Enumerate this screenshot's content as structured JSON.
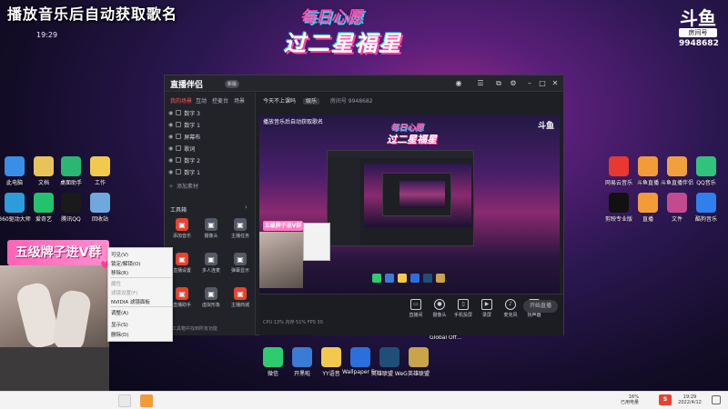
{
  "overlay": {
    "title": "播放音乐后自动获取歌名",
    "time": "19:29",
    "wish_line1": "每日心愿",
    "wish_line2": "过二星福星",
    "level_banner": "五级牌子进V群"
  },
  "platform": {
    "logo": "斗鱼",
    "room_label": "房间号",
    "room_number": "9948682"
  },
  "desktop_left": [
    {
      "label": "此电脑",
      "icon": "computer-icon",
      "color": "#3a8ee6"
    },
    {
      "label": "文档",
      "icon": "document-icon",
      "color": "#e8c35a"
    },
    {
      "label": "桌面助手",
      "icon": "assistant-icon",
      "color": "#2bb673"
    },
    {
      "label": "工作",
      "icon": "folder-icon",
      "color": "#f2c94c"
    },
    {
      "label": "360驱动大师",
      "icon": "driver-icon",
      "color": "#2d9cdb"
    },
    {
      "label": "爱奇艺",
      "icon": "iqiyi-icon",
      "color": "#25c26e"
    },
    {
      "label": "腾讯QQ",
      "icon": "qq-icon",
      "color": "#1a1a1a"
    },
    {
      "label": "回收站",
      "icon": "recycle-bin-icon",
      "color": "#6ea8dc"
    }
  ],
  "desktop_right": [
    {
      "label": "网易云音乐",
      "icon": "netease-music-icon",
      "color": "#e8382f"
    },
    {
      "label": "斗鱼直播",
      "icon": "douyu-icon",
      "color": "#f29b38"
    },
    {
      "label": "斗鱼直播伴侣",
      "icon": "douyu-companion-icon",
      "color": "#f2a03d"
    },
    {
      "label": "QQ音乐",
      "icon": "qq-music-icon",
      "color": "#31c27c"
    },
    {
      "label": "剪映专业版",
      "icon": "capcut-icon",
      "color": "#111111"
    },
    {
      "label": "直播",
      "icon": "live-icon",
      "color": "#f29b38"
    },
    {
      "label": "文件",
      "icon": "file-icon",
      "color": "#c24a8e"
    },
    {
      "label": "酷狗音乐",
      "icon": "kugou-icon",
      "color": "#2f80ed"
    }
  ],
  "desktop_bottom": [
    {
      "label": "微信",
      "icon": "wechat-icon",
      "color": "#2ecc71"
    },
    {
      "label": "开黑啦",
      "icon": "kaiheila-icon",
      "color": "#3a7bd5"
    },
    {
      "label": "YY语音",
      "icon": "yy-icon",
      "color": "#f2c94c"
    },
    {
      "label": "Wallpaper Engine",
      "icon": "wallpaper-engine-icon",
      "color": "#2a6fdb"
    },
    {
      "label": "英雄联盟 WeGame版",
      "icon": "lol-wegame-icon",
      "color": "#1f4e79"
    },
    {
      "label": "英雄联盟",
      "icon": "lol-icon",
      "color": "#c9a44a"
    }
  ],
  "global_off": "Global Off...",
  "app": {
    "name": "直播伴侣",
    "badge": "新版",
    "sidebar_tabs": [
      "我的场景",
      "互动",
      "控麦台",
      "场景"
    ],
    "scenes": [
      "数字 3",
      "数字 1",
      "屏幕布",
      "歌词",
      "数字 2",
      "数字 1"
    ],
    "add_scene": "添加素材",
    "tools_header": "工具箱",
    "tools": [
      {
        "label": "添加音乐",
        "color": "#e8432f"
      },
      {
        "label": "摄像头",
        "color": "#555a66"
      },
      {
        "label": "主播任务",
        "color": "#555a66"
      },
      {
        "label": "直播设置",
        "color": "#e8432f"
      },
      {
        "label": "多人连麦",
        "color": "#555a66"
      },
      {
        "label": "弹幕显示",
        "color": "#555a66"
      },
      {
        "label": "直播助手",
        "color": "#e8432f"
      },
      {
        "label": "虚拟形象",
        "color": "#555a66"
      },
      {
        "label": "主播商城",
        "color": "#e8432f"
      }
    ],
    "tool_footer": "工具箱中找到所有功能",
    "top_info": "今天不上课吗",
    "top_tag": "娱乐",
    "room_label": "房间号 9948682",
    "bottom_buttons": [
      "直播间",
      "摄像头",
      "手机投屏",
      "录屏",
      "麦克风",
      "扬声器"
    ],
    "start_live": "开始直播",
    "status": "CPU 13%  内存 51%  FPS 30"
  },
  "context_menu": {
    "items": [
      "可见(V)",
      "锁定/解锁(O)",
      "移除(R)",
      "属性",
      "滤镜设置(F)",
      "NVIDIA 滤镜面板",
      "调整(A)",
      "显示(S)",
      "删除(D)"
    ]
  },
  "taskbar": {
    "tray_line1": "16%",
    "tray_line2": "已用电量",
    "time": "19:29",
    "date": "2022/4/12",
    "badge": "S"
  }
}
